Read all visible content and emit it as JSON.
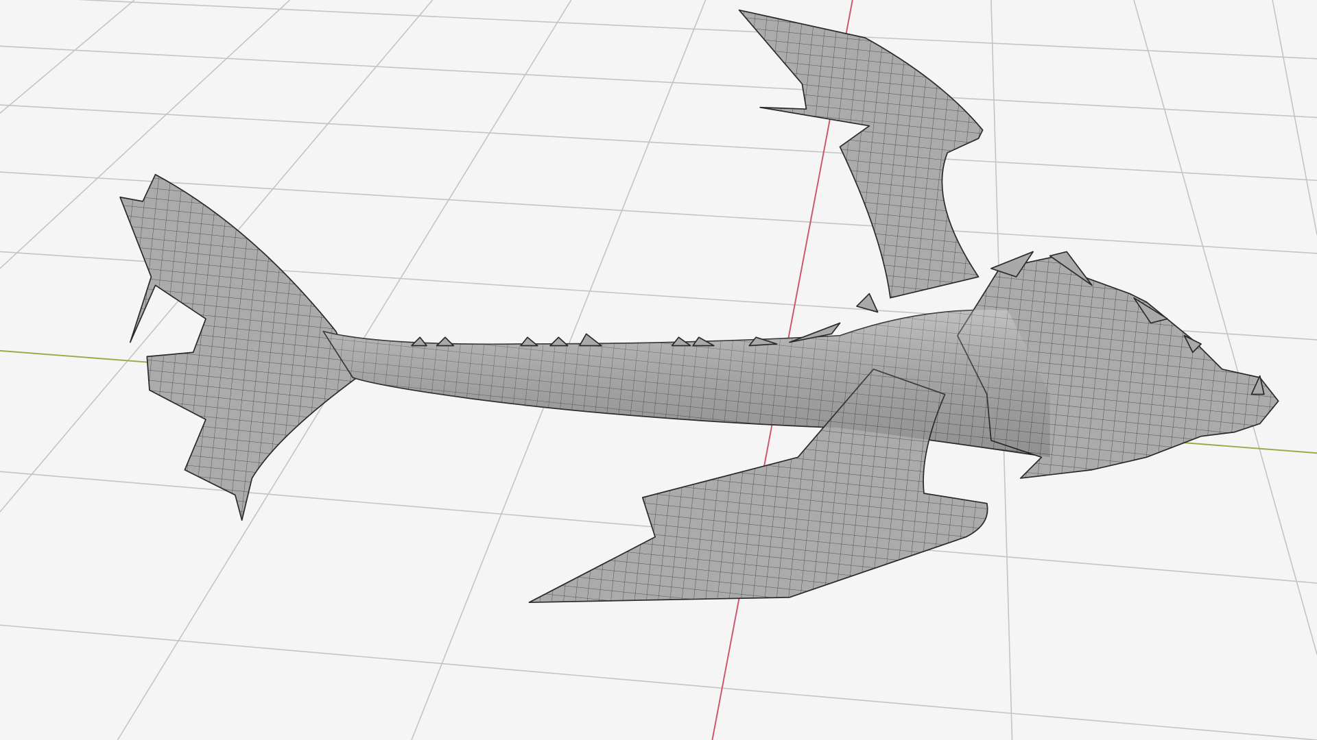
{
  "viewport": {
    "background": "#f5f5f5",
    "grid_color": "#c4c4c4",
    "x_axis_color": "#c9566b",
    "y_axis_color": "#93ad4a",
    "model_color": "#a9a9a9",
    "wire_color": "#2a2a2a"
  }
}
